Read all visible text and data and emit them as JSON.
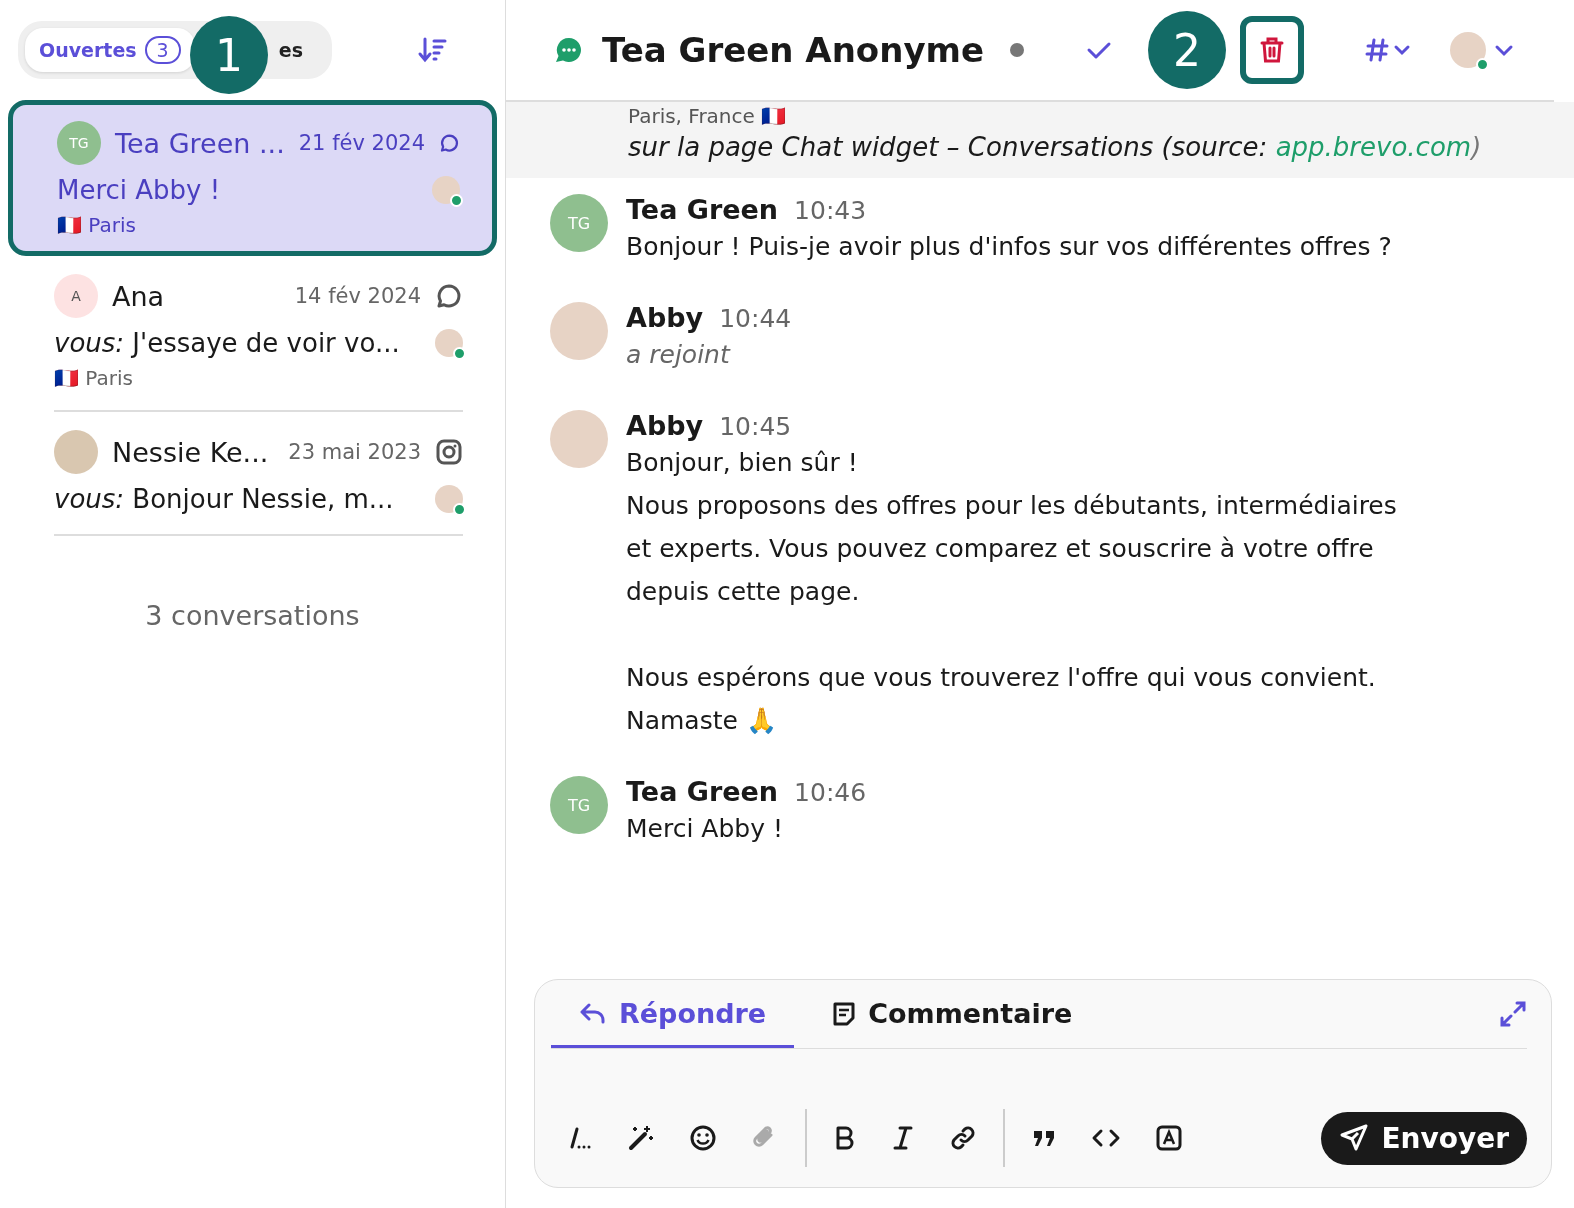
{
  "sidebar": {
    "tabs": [
      {
        "label": "Ouvertes",
        "count": "3",
        "selected": true
      },
      {
        "label": "es",
        "selected": false
      }
    ],
    "callout": "1",
    "conversations": [
      {
        "avatar": {
          "kind": "initials",
          "text": "TG",
          "color": "#8fbf8f"
        },
        "name": "Tea Green ...",
        "date": "21 fév 2024",
        "kind": "chat",
        "preview": "Merci Abby !",
        "location": "🇫🇷 Paris",
        "selected": true
      },
      {
        "avatar": {
          "kind": "initials",
          "text": "A",
          "color": "#fde2e2"
        },
        "name": "Ana",
        "date": "14 fév 2024",
        "kind": "chat",
        "preview": "*vous:* J'essaye de voir vo...",
        "location": "🇫🇷 Paris",
        "selected": false
      },
      {
        "avatar": {
          "kind": "photo"
        },
        "name": "Nessie Ke...",
        "date": "23 mai 2023",
        "kind": "instagram",
        "preview": "*vous:* Bonjour Nessie, m...",
        "selected": false
      }
    ],
    "footer": "3 conversations"
  },
  "header": {
    "title": "Tea Green Anonyme",
    "callout": "2"
  },
  "context": {
    "location": "Paris, France 🇫🇷",
    "page_line": "*sur la page* Chat widget – Conversations *(source:* ",
    "link": "app.brevo.com",
    "close": ")"
  },
  "messages": [
    {
      "author": "Tea Green",
      "time": "10:43",
      "avatar": {
        "kind": "initials",
        "text": "TG"
      },
      "kind": "text",
      "body": "Bonjour ! Puis-je avoir plus d'infos sur vos différentes offres ?"
    },
    {
      "author": "Abby",
      "time": "10:44",
      "avatar": {
        "kind": "photo"
      },
      "kind": "event",
      "body": "a rejoint"
    },
    {
      "author": "Abby",
      "time": "10:45",
      "avatar": {
        "kind": "photo"
      },
      "kind": "text",
      "body": "Bonjour, bien sûr !\nNous proposons des offres pour les débutants, intermédiaires\net experts. Vous pouvez comparez et souscrire à votre offre\ndepuis cette page.\n\nNous espérons que vous trouverez l'offre qui vous convient.\nNamaste 🙏"
    },
    {
      "author": "Tea Green",
      "time": "10:46",
      "avatar": {
        "kind": "initials",
        "text": "TG"
      },
      "kind": "text",
      "body": "Merci Abby !"
    }
  ],
  "composer": {
    "tabs": [
      {
        "label": "Répondre",
        "kind": "reply",
        "selected": true
      },
      {
        "label": "Commentaire",
        "kind": "note",
        "selected": false
      }
    ],
    "tools": [
      [
        {
          "kind": "format",
          "disabled": false
        },
        {
          "kind": "magic",
          "disabled": false
        },
        {
          "kind": "emoji",
          "disabled": false
        },
        {
          "kind": "attach",
          "disabled": true
        }
      ],
      [
        {
          "kind": "bold",
          "disabled": false
        },
        {
          "kind": "italic",
          "disabled": false
        },
        {
          "kind": "link",
          "disabled": false
        }
      ],
      [
        {
          "kind": "quote",
          "disabled": false
        },
        {
          "kind": "code",
          "disabled": false
        },
        {
          "kind": "template",
          "disabled": false
        }
      ]
    ],
    "send": "Envoyer"
  }
}
